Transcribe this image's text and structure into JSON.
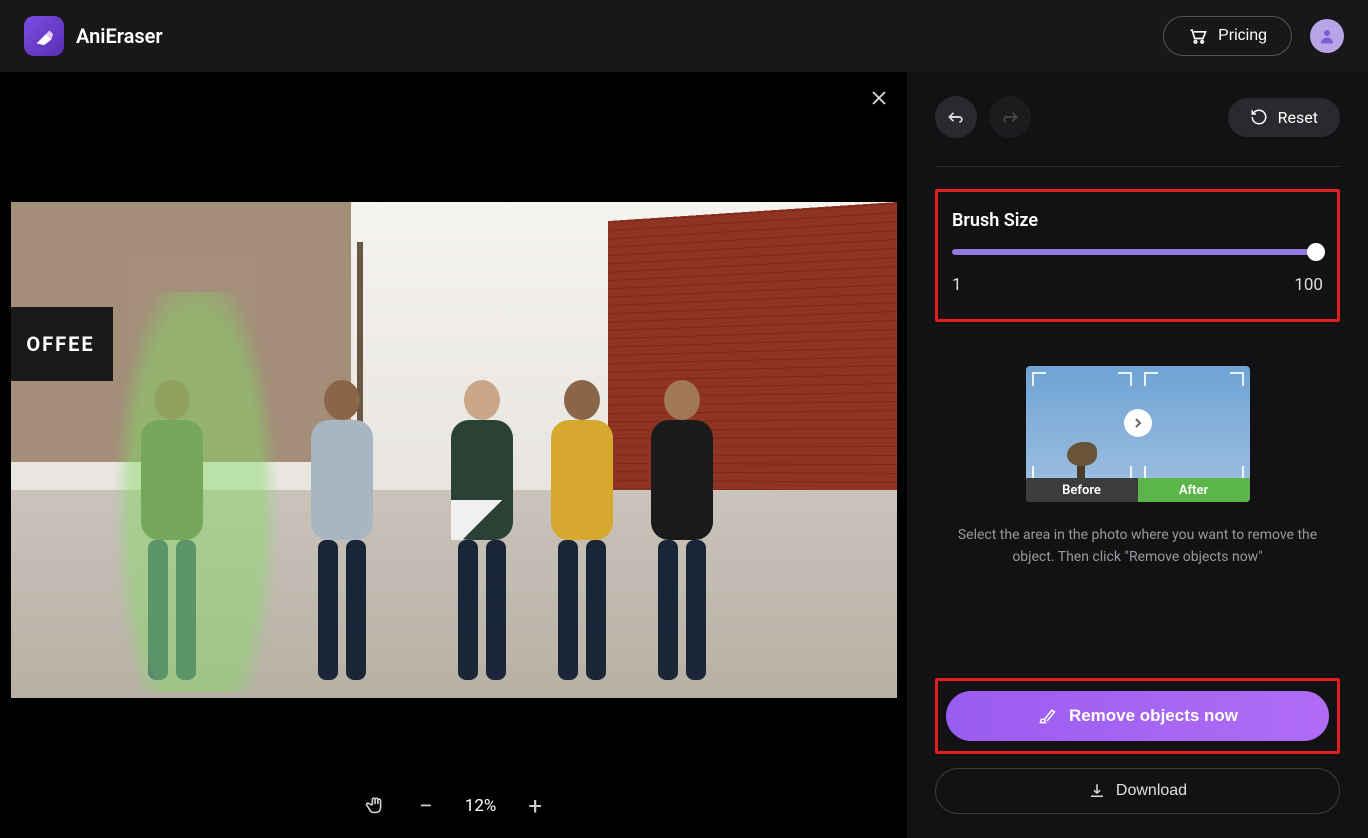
{
  "header": {
    "app_name": "AniEraser",
    "pricing_label": "Pricing"
  },
  "canvas": {
    "coffee_sign": "OFFEE",
    "zoom_percent": "12%"
  },
  "sidebar": {
    "reset_label": "Reset",
    "brush": {
      "title": "Brush Size",
      "min": "1",
      "max": "100"
    },
    "preview": {
      "before_label": "Before",
      "after_label": "After"
    },
    "instructions": "Select the area in the photo where you want to remove the object. Then click \"Remove objects now\"",
    "remove_label": "Remove objects now",
    "download_label": "Download"
  }
}
